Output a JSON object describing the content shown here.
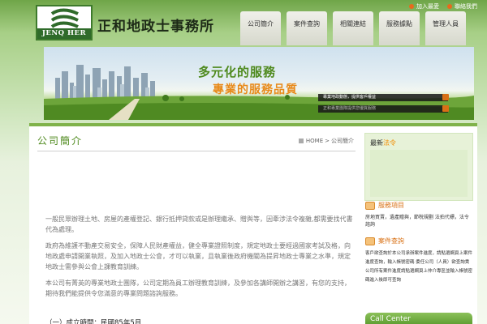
{
  "header": {
    "logo_text": "JENQ HER",
    "site_title": "正和地政士事務所",
    "top_links": [
      {
        "label": "加入最愛"
      },
      {
        "label": "聯絡我們"
      }
    ],
    "nav": [
      {
        "label": "公司簡介"
      },
      {
        "label": "案件查詢"
      },
      {
        "label": "相關連結"
      },
      {
        "label": "服務據點"
      },
      {
        "label": "管理人員"
      }
    ]
  },
  "banner": {
    "slogan_1": "多元化的服務",
    "slogan_2": "專業的服務品質",
    "caption_1": "專業地政動態，提供客戶權益",
    "caption_2": "正和專業團隊提供您優質服務"
  },
  "main": {
    "title": "公司簡介",
    "breadcrumb_home": "HOME",
    "breadcrumb_sep": ">",
    "breadcrumb_current": "公司簡介",
    "paragraphs": [
      "一般民眾辦理土地、房屋的產權登記、銀行抵押貸款或是辦理繼承、贈與等，因牽涉法令複雜,都需要找代書代為處理。",
      "政府為維護不動產交易安全，保障人民財產權益，健全專業證照制度，規定地政士要經過國家考試及格，向地政處申請開業執照，及加入地政士公會，才可以執業，且執業後政府機關為提昇地政士專業之水準，規定地政士需參與公會上課教育訓練。",
      "本公司有菁英的專業地政士團隊，公司定期為員工辦理教育訓練，及參加各講師開辦之講習，有您的支持，期待我們能提供令您滿意的專業問題諮詢服務。"
    ],
    "established": "（一）成立時間：民國85年5月"
  },
  "sidebar": {
    "news_title": "最新",
    "news_title_accent": "法令",
    "services_title": "服務項目",
    "services_text": "房地買賣，遺產贈與，節稅規劃 法拍代標，法令諮詢",
    "query_title": "案件查詢",
    "query_text": "客戶欲查詢於本公司承辦案件進度，請點選網頁上案件進度查詢，輸入帳號密碼 委任公司（人員）欲查詢貴公司所有案件進度請點選網頁上仲介專區並輸入帳號密碼進入後即可查詢",
    "call_center": "Call Center"
  },
  "colors": {
    "brand_green": "#4f8a1e",
    "accent_orange": "#e88a1a",
    "header_green": "#6fa548"
  },
  "icons": [
    "logo-mark",
    "dot-icon",
    "home-icon",
    "service-icon",
    "query-icon"
  ]
}
